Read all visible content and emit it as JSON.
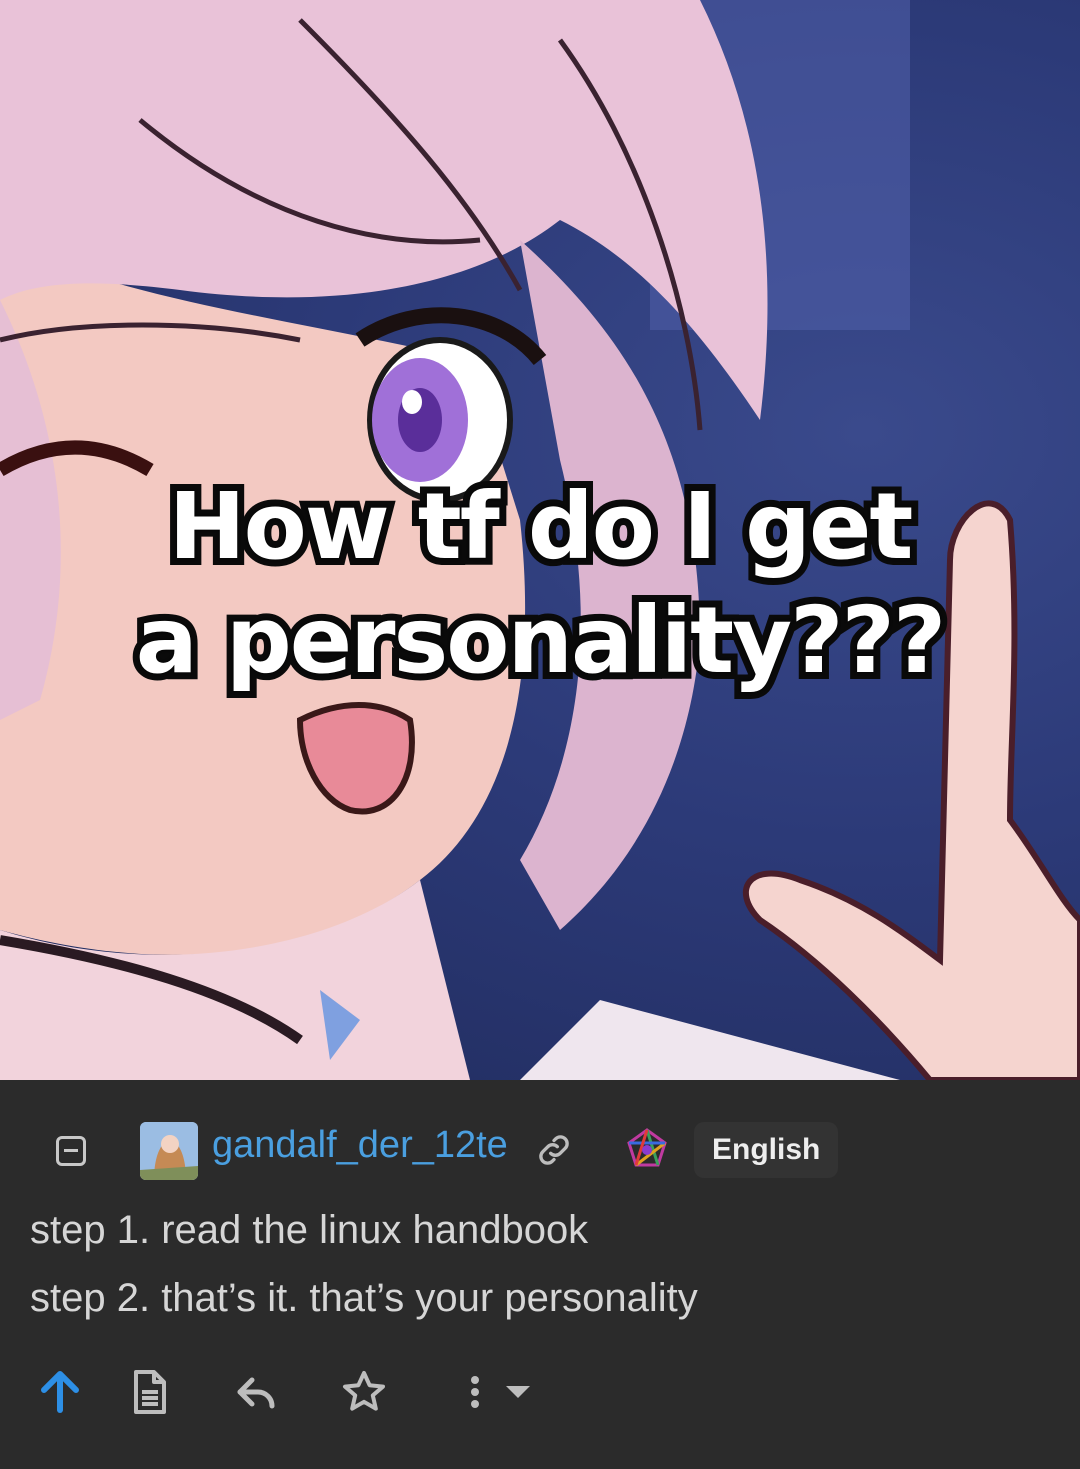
{
  "meme": {
    "caption_line1": "How tf do I get",
    "caption_line2": "a personality???"
  },
  "comment": {
    "username": "gandalf_der_12te",
    "language": "English",
    "lines": [
      "step 1. read the linux handbook",
      "step 2. that’s it. that’s your personality"
    ]
  },
  "icons": {
    "collapse": "minus-square-icon",
    "link": "link-icon",
    "instance": "instance-logo-icon",
    "upvote": "arrow-up-icon",
    "source": "document-icon",
    "reply": "reply-icon",
    "save": "star-icon",
    "more": "kebab-menu-icon",
    "dropdown": "chevron-down-icon"
  },
  "colors": {
    "background": "#2b2b2b",
    "username": "#4a9fe0",
    "upvote": "#2d8fe6",
    "text": "#d6d6d6"
  }
}
